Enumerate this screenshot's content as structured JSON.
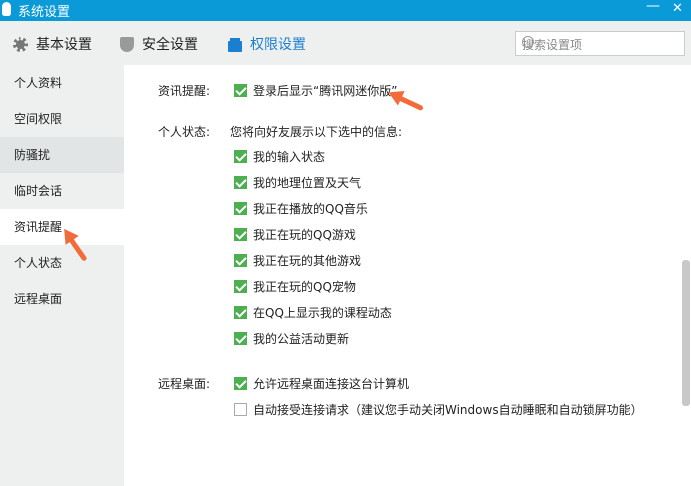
{
  "window": {
    "title": "系统设置",
    "minimize": "—",
    "close": "✕"
  },
  "tabs": [
    {
      "label": "基本设置",
      "icon": "gear-icon"
    },
    {
      "label": "安全设置",
      "icon": "shield-icon"
    },
    {
      "label": "权限设置",
      "icon": "lock-icon",
      "active": true
    }
  ],
  "search": {
    "placeholder": "搜索设置项"
  },
  "sidebar": {
    "items": [
      {
        "label": "个人资料"
      },
      {
        "label": "空间权限"
      },
      {
        "label": "防骚扰"
      },
      {
        "label": "临时会话"
      },
      {
        "label": "资讯提醒",
        "active": true
      },
      {
        "label": "个人状态"
      },
      {
        "label": "远程桌面"
      }
    ]
  },
  "main": {
    "news": {
      "label": "资讯提醒:",
      "option": {
        "label": "登录后显示“腾讯网迷你版”",
        "checked": true
      }
    },
    "status": {
      "label": "个人状态:",
      "desc": "您将向好友展示以下选中的信息:",
      "options": [
        {
          "label": "我的输入状态",
          "checked": true
        },
        {
          "label": "我的地理位置及天气",
          "checked": true
        },
        {
          "label": "我正在播放的QQ音乐",
          "checked": true
        },
        {
          "label": "我正在玩的QQ游戏",
          "checked": true
        },
        {
          "label": "我正在玩的其他游戏",
          "checked": true
        },
        {
          "label": "我正在玩的QQ宠物",
          "checked": true
        },
        {
          "label": "在QQ上显示我的课程动态",
          "checked": true
        },
        {
          "label": "我的公益活动更新",
          "checked": true
        }
      ]
    },
    "remote": {
      "label": "远程桌面:",
      "options": [
        {
          "label": "允许远程桌面连接这台计算机",
          "checked": true
        },
        {
          "label": "自动接受连接请求（建议您手动关闭Windows自动睡眠和自动锁屏功能）",
          "checked": false
        }
      ]
    }
  },
  "colors": {
    "accent": "#0a9ad8",
    "check": "#4caf50",
    "arrow": "#f26b3a"
  }
}
